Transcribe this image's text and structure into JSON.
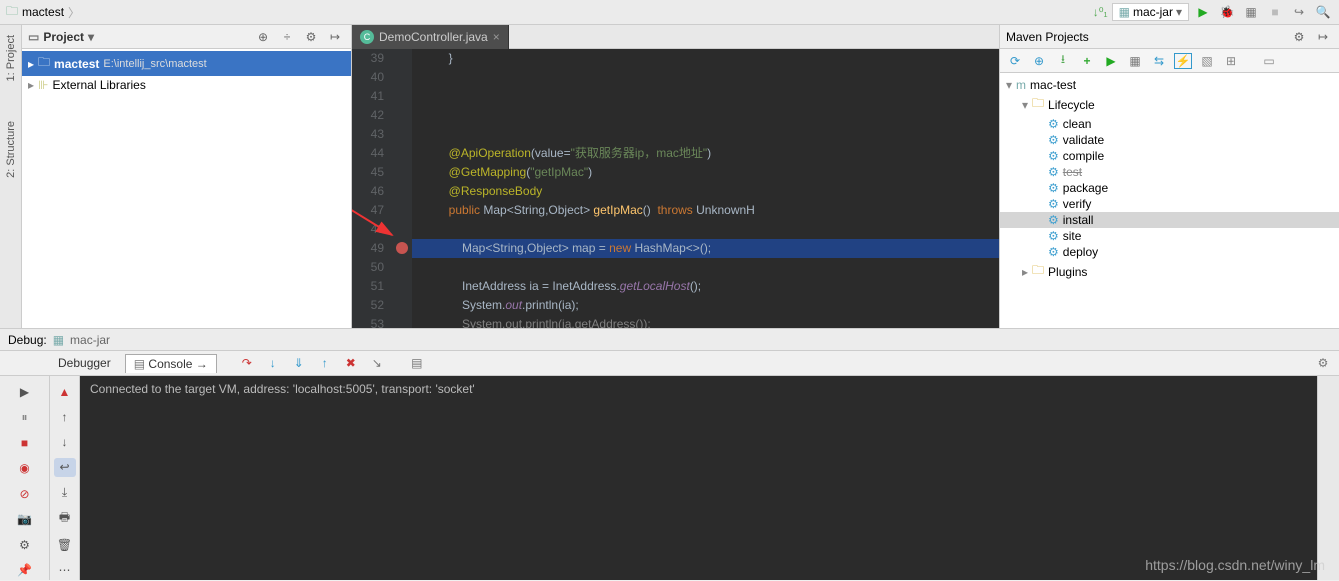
{
  "breadcrumb": {
    "project": "mactest"
  },
  "toolbar": {
    "config_label": "mac-jar"
  },
  "project_panel": {
    "title": "Project",
    "root": "mactest",
    "root_path": "E:\\intellij_src\\mactest",
    "ext_libs": "External Libraries"
  },
  "sidebar": {
    "project_label": "1: Project",
    "structure_label": "2: Structure"
  },
  "editor": {
    "tab": "DemoController.java",
    "lines": [
      {
        "n": 39,
        "t": "        }"
      },
      {
        "n": 40,
        "t": ""
      },
      {
        "n": 41,
        "t": ""
      },
      {
        "n": 42,
        "t": ""
      },
      {
        "n": 43,
        "t": ""
      },
      {
        "n": 44,
        "t": "        @ApiOperation(value=\"获取服务器ip，mac地址\")"
      },
      {
        "n": 45,
        "t": "        @GetMapping(\"getIpMac\")"
      },
      {
        "n": 46,
        "t": "        @ResponseBody"
      },
      {
        "n": 47,
        "t": "        public Map<String,Object> getIpMac()  throws UnknownH"
      },
      {
        "n": 48,
        "t": ""
      },
      {
        "n": 49,
        "t": "            Map<String,Object> map = new HashMap<>();"
      },
      {
        "n": 50,
        "t": ""
      },
      {
        "n": 51,
        "t": "            InetAddress ia = InetAddress.getLocalHost();"
      },
      {
        "n": 52,
        "t": "            System.out.println(ia);"
      },
      {
        "n": 53,
        "t": "            System.out.println(ia.getAddress());"
      }
    ]
  },
  "maven": {
    "title": "Maven Projects",
    "root": "mac-test",
    "lifecycle": "Lifecycle",
    "goals": [
      "clean",
      "validate",
      "compile",
      "test",
      "package",
      "verify",
      "install",
      "site",
      "deploy"
    ],
    "selected_goal": "install",
    "plugins": "Plugins"
  },
  "debug": {
    "label": "Debug:",
    "target": "mac-jar",
    "tab_debugger": "Debugger",
    "tab_console": "Console",
    "console_text": "Connected to the target VM, address: 'localhost:5005', transport: 'socket'"
  },
  "watermark": "https://blog.csdn.net/winy_lm"
}
